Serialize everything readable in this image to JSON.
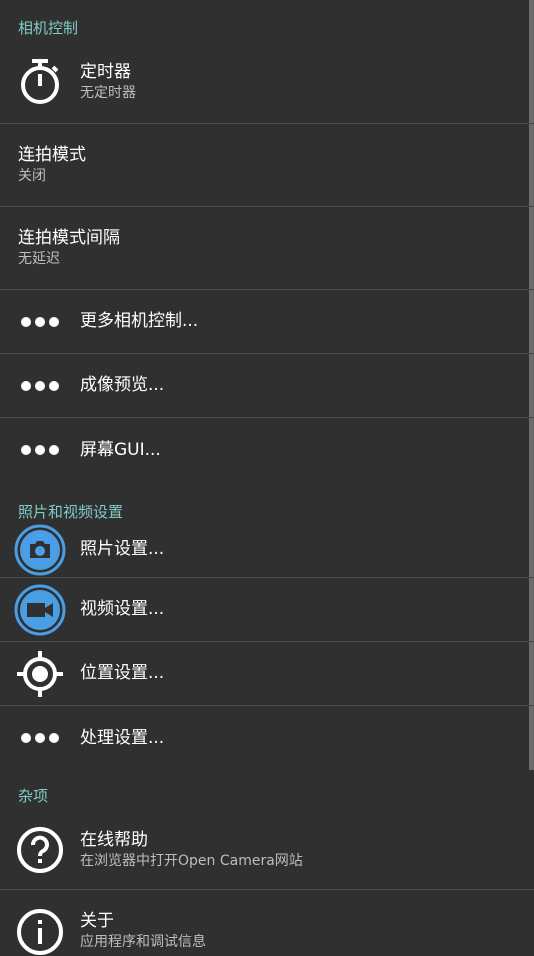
{
  "sections": {
    "camera_controls": "相机控制",
    "photo_video": "照片和视频设置",
    "misc": "杂项"
  },
  "items": {
    "timer": {
      "title": "定时器",
      "summary": "无定时器"
    },
    "burst_mode": {
      "title": "连拍模式",
      "summary": "关闭"
    },
    "burst_interval": {
      "title": "连拍模式间隔",
      "summary": "无延迟"
    },
    "more_camera_controls": {
      "title": "更多相机控制..."
    },
    "preview": {
      "title": "成像预览..."
    },
    "on_screen_gui": {
      "title": "屏幕GUI..."
    },
    "photo_settings": {
      "title": "照片设置..."
    },
    "video_settings": {
      "title": "视频设置..."
    },
    "location_settings": {
      "title": "位置设置..."
    },
    "processing_settings": {
      "title": "处理设置..."
    },
    "online_help": {
      "title": "在线帮助",
      "summary": "在浏览器中打开Open Camera网站"
    },
    "about": {
      "title": "关于",
      "summary": "应用程序和调试信息"
    }
  },
  "colors": {
    "background": "#303030",
    "accent": "#80cbc4",
    "icon_blue": "#4a9ee6"
  },
  "icons": {
    "timer": "stopwatch-icon",
    "more": "more-horiz-icon",
    "photo": "camera-icon",
    "video": "videocam-icon",
    "location": "gps-fixed-icon",
    "help": "help-icon",
    "about": "info-icon"
  }
}
